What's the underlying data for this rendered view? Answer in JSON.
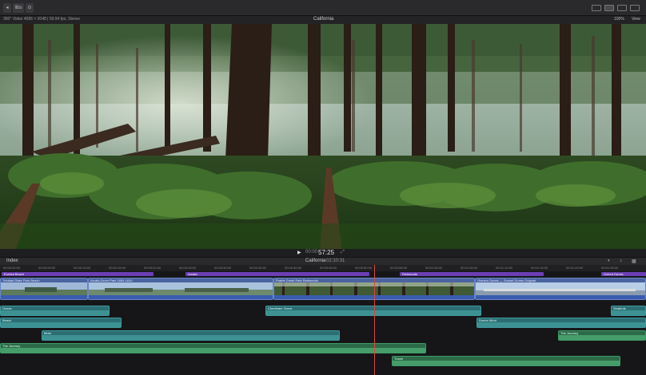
{
  "top_bar": {
    "left_buttons": [
      "◂",
      "libs",
      "⊙"
    ],
    "zoom": "100%",
    "view_menu": "View"
  },
  "info_bar": {
    "format": "360° Video 4096 × 2048 | 59.94 fps, Stereo",
    "title": "California"
  },
  "transport": {
    "timecode": "57:25",
    "prefix": "00:00"
  },
  "timeline_header": {
    "index_label": "Index",
    "project_name": "California",
    "duration": "02:10:31"
  },
  "ruler": [
    "00:00:00:00",
    "00:00:05:00",
    "00:00:10:00",
    "00:00:15:00",
    "00:00:20:00",
    "00:00:25:00",
    "00:00:30:00",
    "00:00:35:00",
    "00:00:40:00",
    "00:00:45:00",
    "00:00:50:00",
    "00:00:55:00",
    "00:01:00:00",
    "00:01:05:00",
    "00:01:10:00",
    "00:01:15:00",
    "00:01:20:00",
    "00:01:25:00"
  ],
  "chapters": [
    "Eureka Beach",
    "Arcata",
    "Redwoods",
    "Oxford Dunes"
  ],
  "video_clips": [
    "Trinidad State Park Beach",
    "Arcata Zoom Park 1809-1810",
    "Prairie Creek Park Redwoods",
    "Oceano Dunes — Sunset Dunes Original"
  ],
  "audio_clips": [
    "Ocean",
    "Cheetham Grove",
    "Seabirds",
    "Beach",
    "Dunes Wind",
    "Birds",
    "The Journey",
    "The Journey",
    "Travel"
  ],
  "colors": {
    "chapter": "#6b3fb3",
    "video_clip": "#4a64a0",
    "audio_teal": "#2b6e74",
    "audio_green": "#2c6a48",
    "playhead": "#e0463c"
  }
}
